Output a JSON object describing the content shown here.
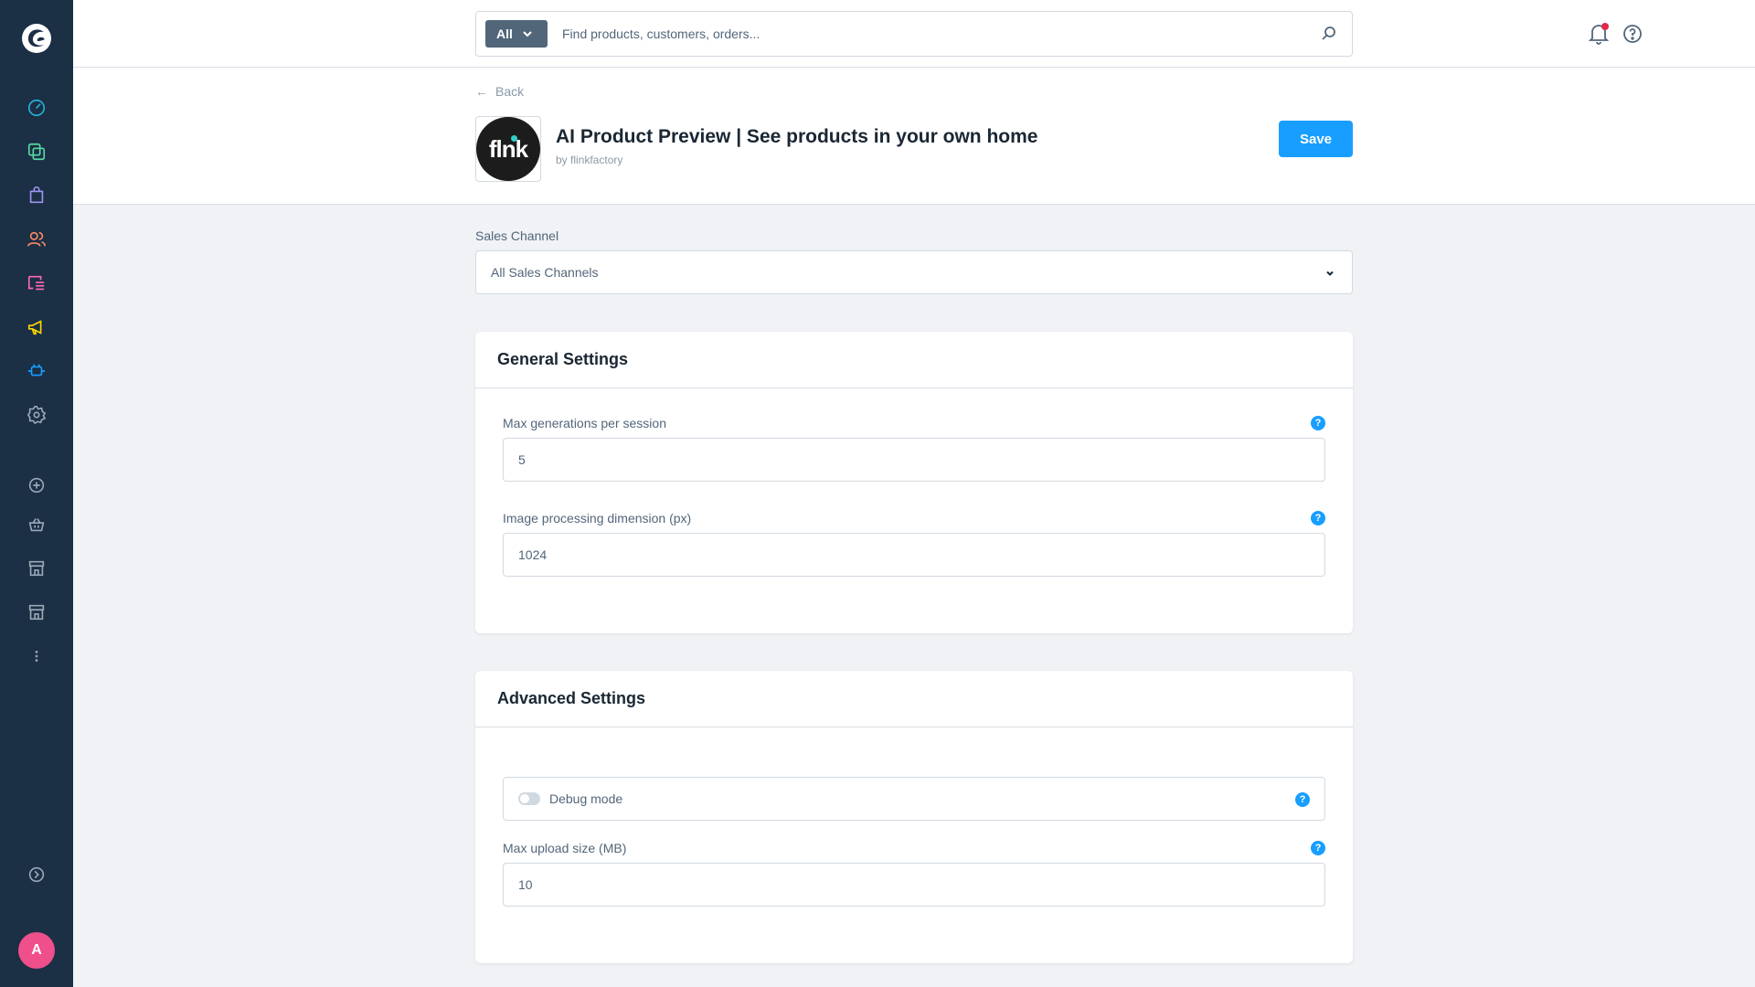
{
  "sidebar": {
    "avatar_initial": "A",
    "items": [
      {
        "icon": "dashboard-icon",
        "color": "#26b0d5"
      },
      {
        "icon": "catalogues-icon",
        "color": "#57d9a3"
      },
      {
        "icon": "orders-icon",
        "color": "#a092f0"
      },
      {
        "icon": "customers-icon",
        "color": "#f88962"
      },
      {
        "icon": "content-icon",
        "color": "#ff68b4"
      },
      {
        "icon": "marketing-icon",
        "color": "#ffd700"
      },
      {
        "icon": "extensions-icon",
        "color": "#189eff"
      },
      {
        "icon": "settings-icon",
        "color": "#9aa8b5"
      },
      {
        "icon": "add-sales-channel-icon",
        "color": "#9aa8b5"
      },
      {
        "icon": "headless-channel-icon",
        "color": "#9aa8b5"
      },
      {
        "icon": "storefront-icon",
        "color": "#9aa8b5"
      },
      {
        "icon": "storefront-2-icon",
        "color": "#9aa8b5"
      },
      {
        "icon": "more-icon",
        "color": "#9aa8b5"
      },
      {
        "icon": "collapse-sidebar-icon",
        "color": "#9aa8b5"
      }
    ]
  },
  "search": {
    "type_label": "All",
    "placeholder": "Find products, customers, orders..."
  },
  "header": {
    "back_label": "Back",
    "app_logo_text": "flnk",
    "app_title": "AI Product Preview | See products in your own home",
    "app_author": "by flinkfactory",
    "save_label": "Save"
  },
  "sales_channel": {
    "label": "Sales Channel",
    "value": "All Sales Channels"
  },
  "general_settings": {
    "title": "General Settings",
    "fields": [
      {
        "label": "Max generations per session",
        "value": "5"
      },
      {
        "label": "Image processing dimension (px)",
        "value": "1024"
      }
    ]
  },
  "advanced_settings": {
    "title": "Advanced Settings",
    "debug_label": "Debug mode",
    "debug_enabled": false,
    "upload_label": "Max upload size (MB)",
    "upload_value": "10"
  },
  "colors": {
    "accent": "#189eff",
    "sidebar_bg": "#1b2f45",
    "avatar": "#ef4f8a"
  }
}
